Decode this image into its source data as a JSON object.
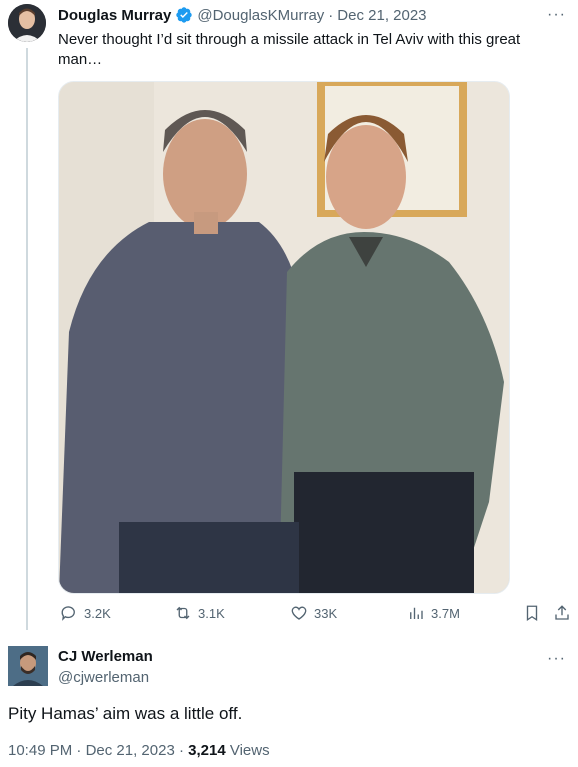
{
  "quoted_tweet": {
    "author_name": "Douglas Murray",
    "handle": "@DouglasKMurray",
    "separator": "·",
    "date": "Dec 21, 2023",
    "text": "Never thought I’d sit through a missile attack in Tel Aviv with this great man…",
    "more_label": "···",
    "verified_color": "#1d9bf0",
    "stats": {
      "replies": "3.2K",
      "retweets": "3.1K",
      "likes": "33K",
      "views": "3.7M"
    }
  },
  "main_tweet": {
    "author_name": "CJ Werleman",
    "handle": "@cjwerleman",
    "more_label": "···",
    "text": "Pity Hamas’ aim was a little off.",
    "time": "10:49 PM",
    "separator1": "·",
    "date": "Dec 21, 2023",
    "separator2": "·",
    "views_count": "3,214",
    "views_label": "Views"
  }
}
